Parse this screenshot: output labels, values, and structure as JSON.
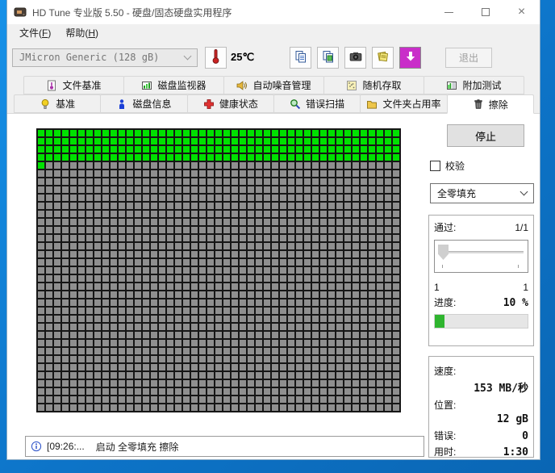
{
  "window": {
    "title": "HD Tune 专业版 5.50 - 硬盘/固态硬盘实用程序",
    "close_glyph": "×"
  },
  "menu": {
    "file": {
      "pre": "文件(",
      "key": "F",
      "post": ")"
    },
    "help": {
      "pre": "帮助(",
      "key": "H",
      "post": ")"
    }
  },
  "toolbar": {
    "drive_select": "JMicron Generic (128 gB)",
    "temperature": "25℃",
    "exit_label": "退出"
  },
  "tabs": {
    "row1": [
      {
        "label": "文件基准",
        "icon": "file-benchmark-icon"
      },
      {
        "label": "磁盘监视器",
        "icon": "disk-monitor-icon"
      },
      {
        "label": "自动噪音管理",
        "icon": "speaker-icon"
      },
      {
        "label": "随机存取",
        "icon": "random-access-icon"
      },
      {
        "label": "附加测试",
        "icon": "extra-tests-icon"
      }
    ],
    "row2": [
      {
        "label": "基准",
        "icon": "bulb-icon"
      },
      {
        "label": "磁盘信息",
        "icon": "disk-info-icon"
      },
      {
        "label": "健康状态",
        "icon": "health-cross-icon"
      },
      {
        "label": "错误扫描",
        "icon": "magnifier-icon"
      },
      {
        "label": "文件夹占用率",
        "icon": "folder-icon"
      },
      {
        "label": "擦除",
        "icon": "trash-icon",
        "active": true
      }
    ]
  },
  "erase": {
    "stop_label": "停止",
    "verify_label": "校验",
    "fill_mode": "全零填充",
    "pass_label": "通过:",
    "pass_value": "1/1",
    "slider_left": "1",
    "slider_right": "1",
    "progress_label": "进度:",
    "progress_value": "10 %",
    "progress_percent": 10,
    "stats": {
      "speed_label": "速度:",
      "speed_value": "153 MB/秒",
      "position_label": "位置:",
      "position_value": "12 gB",
      "errors_label": "错误:",
      "errors_value": "0",
      "time_label": "用时:",
      "time_value": "1:30"
    },
    "grid": {
      "cols": 45,
      "rows": 35,
      "green_cells": 181,
      "green_color": "#00e100",
      "gray_color": "#8f8f8f",
      "line_color": "#161616"
    }
  },
  "statusbar": {
    "time": "[09:26:...",
    "message": "启动 全零填充 擦除"
  }
}
